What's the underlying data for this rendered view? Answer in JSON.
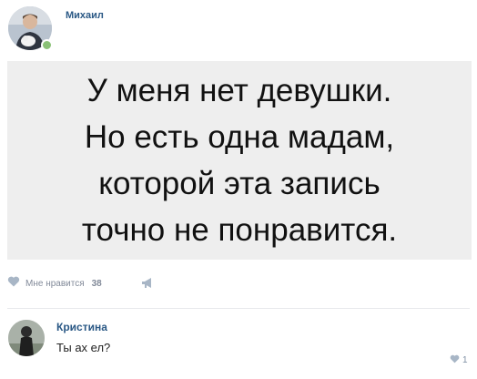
{
  "post": {
    "author": "Михаил",
    "author_online": true,
    "image_text_lines": [
      "У меня нет девушки.",
      "Но есть одна мадам,",
      "которой эта запись",
      "точно не понравится."
    ]
  },
  "actions": {
    "like_label": "Мне нравится",
    "like_count": "38",
    "like_icon": "heart-icon",
    "share_icon": "megaphone-icon"
  },
  "comment": {
    "author": "Кристина",
    "text": "Ты ах ел?",
    "like_count": "1"
  },
  "colors": {
    "link": "#2a5885",
    "muted": "#828a99",
    "online": "#8ac176"
  }
}
